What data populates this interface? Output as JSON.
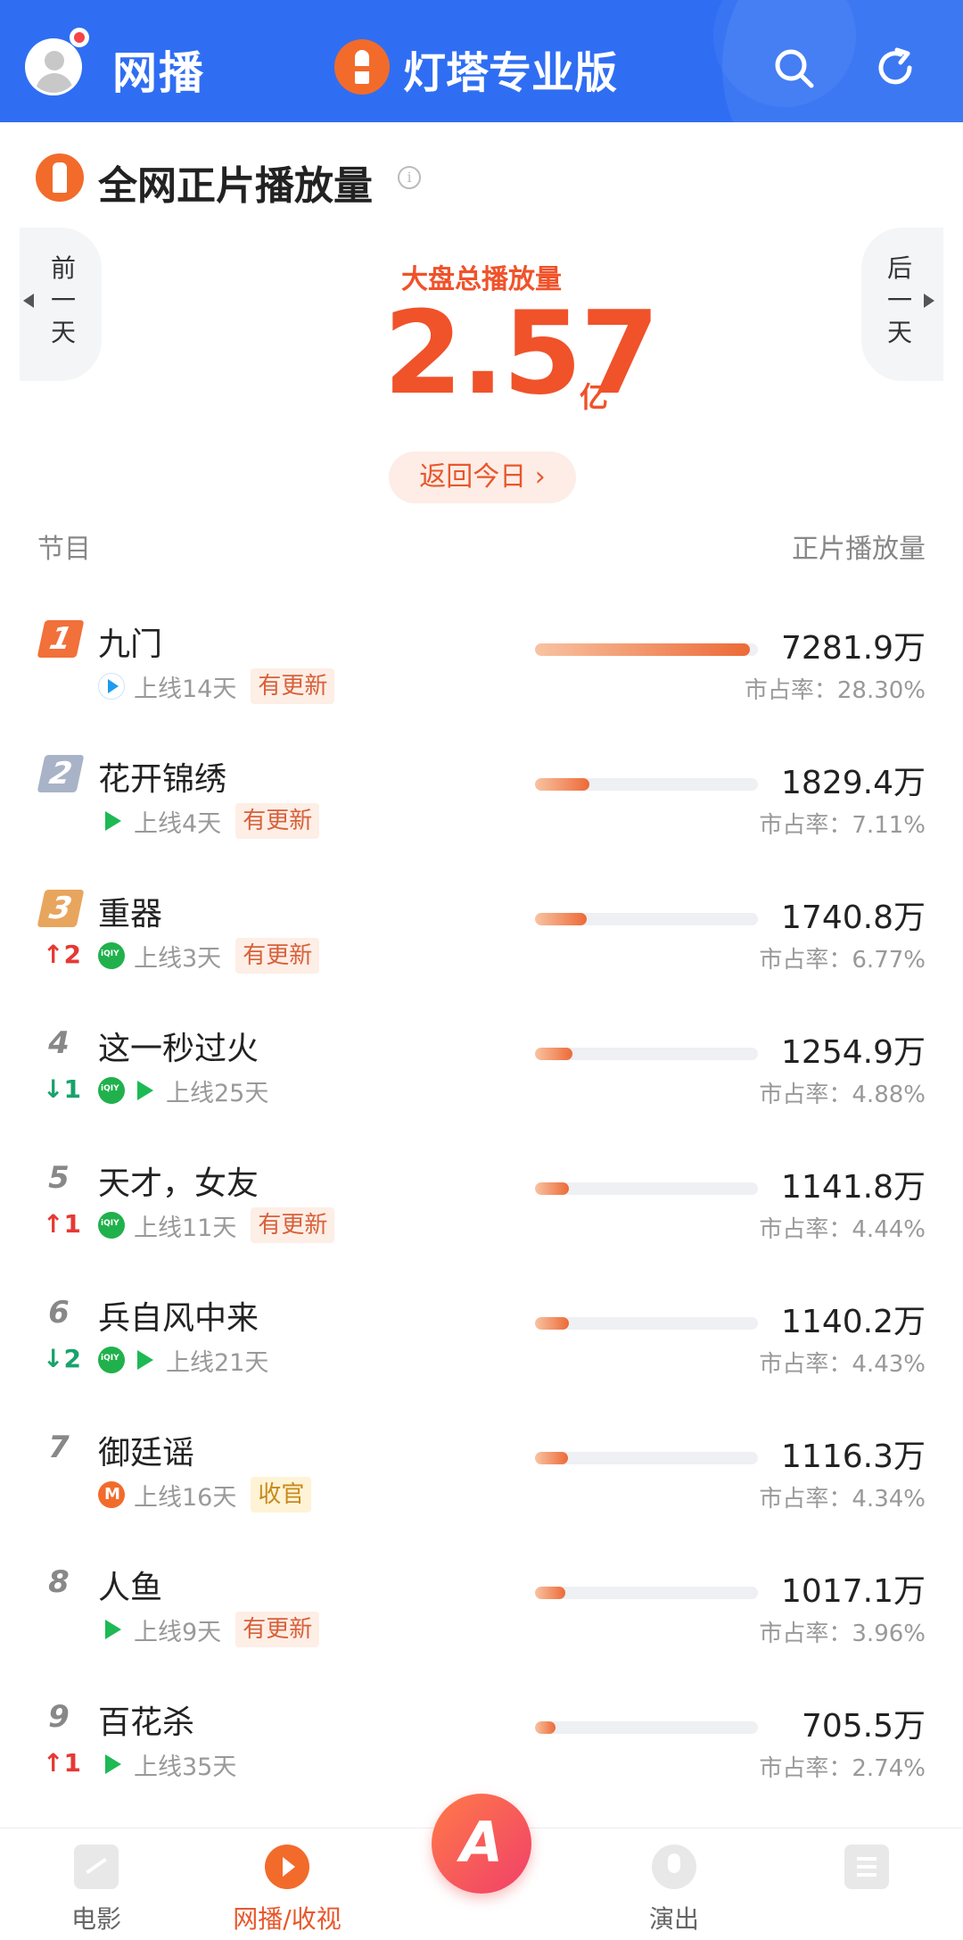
{
  "header": {
    "title": "网播",
    "brand": "灯塔专业版"
  },
  "section": {
    "title": "全网正片播放量"
  },
  "nav": {
    "prev_day": [
      "前",
      "一",
      "天"
    ],
    "next_day": [
      "后",
      "一",
      "天"
    ],
    "return_today": "返回今日 ›"
  },
  "total": {
    "label": "大盘总播放量",
    "value": "2.57",
    "unit": "亿"
  },
  "columns": {
    "left": "节目",
    "right": "正片播放量"
  },
  "rows": [
    {
      "rank": "1",
      "title": "九门",
      "change": "",
      "change_dir": "",
      "platforms": [
        "youku"
      ],
      "days": "上线14天",
      "tag": "有更新",
      "tag_style": "",
      "value": "7281.9万",
      "share": "市占率：28.30%",
      "share_pct": 28.3
    },
    {
      "rank": "2",
      "title": "花开锦绣",
      "change": "",
      "change_dir": "",
      "platforms": [
        "tencent"
      ],
      "days": "上线4天",
      "tag": "有更新",
      "tag_style": "",
      "value": "1829.4万",
      "share": "市占率：7.11%",
      "share_pct": 7.11
    },
    {
      "rank": "3",
      "title": "重器",
      "change": "2",
      "change_dir": "up",
      "platforms": [
        "iqiyi"
      ],
      "days": "上线3天",
      "tag": "有更新",
      "tag_style": "",
      "value": "1740.8万",
      "share": "市占率：6.77%",
      "share_pct": 6.77
    },
    {
      "rank": "4",
      "title": "这一秒过火",
      "change": "1",
      "change_dir": "down",
      "platforms": [
        "iqiyi",
        "tencent"
      ],
      "days": "上线25天",
      "tag": "",
      "tag_style": "",
      "value": "1254.9万",
      "share": "市占率：4.88%",
      "share_pct": 4.88
    },
    {
      "rank": "5",
      "title": "天才，女友",
      "change": "1",
      "change_dir": "up",
      "platforms": [
        "iqiyi"
      ],
      "days": "上线11天",
      "tag": "有更新",
      "tag_style": "",
      "value": "1141.8万",
      "share": "市占率：4.44%",
      "share_pct": 4.44
    },
    {
      "rank": "6",
      "title": "兵自风中来",
      "change": "2",
      "change_dir": "down",
      "platforms": [
        "iqiyi",
        "tencent"
      ],
      "days": "上线21天",
      "tag": "",
      "tag_style": "",
      "value": "1140.2万",
      "share": "市占率：4.43%",
      "share_pct": 4.43
    },
    {
      "rank": "7",
      "title": "御廷谣",
      "change": "",
      "change_dir": "",
      "platforms": [
        "mango"
      ],
      "days": "上线16天",
      "tag": "收官",
      "tag_style": "gold",
      "value": "1116.3万",
      "share": "市占率：4.34%",
      "share_pct": 4.34
    },
    {
      "rank": "8",
      "title": "人鱼",
      "change": "",
      "change_dir": "",
      "platforms": [
        "tencent"
      ],
      "days": "上线9天",
      "tag": "有更新",
      "tag_style": "",
      "value": "1017.1万",
      "share": "市占率：3.96%",
      "share_pct": 3.96
    },
    {
      "rank": "9",
      "title": "百花杀",
      "change": "1",
      "change_dir": "up",
      "platforms": [
        "tencent"
      ],
      "days": "上线35天",
      "tag": "",
      "tag_style": "",
      "value": "705.5万",
      "share": "市占率：2.74%",
      "share_pct": 2.74
    }
  ],
  "bottom_nav": [
    {
      "label": "电影",
      "icon": "movie-icon",
      "active": false
    },
    {
      "label": "网播/收视",
      "icon": "play-icon",
      "active": true
    },
    {
      "label": "演出",
      "icon": "mic-icon",
      "active": false
    },
    {
      "label": "",
      "icon": "doc-icon",
      "active": false
    }
  ],
  "center_button": {
    "label": "A"
  },
  "colors": {
    "header_bg": "#2F6EF3",
    "accent": "#F0522A",
    "bar": "#EC6A37",
    "up": "#E53935",
    "down": "#18A36C"
  }
}
